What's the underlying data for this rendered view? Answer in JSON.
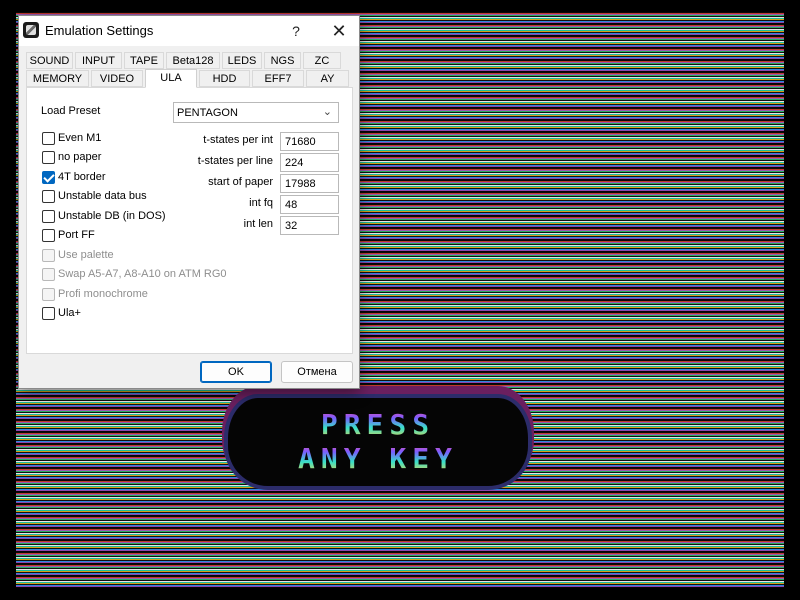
{
  "dialog": {
    "title": "Emulation Settings",
    "help": "?",
    "close": "✕"
  },
  "tabs": {
    "row1": [
      "SOUND",
      "INPUT",
      "TAPE",
      "Beta128",
      "LEDS",
      "NGS",
      "ZC"
    ],
    "row2": [
      "MEMORY",
      "VIDEO",
      "ULA",
      "HDD",
      "EFF7",
      "AY"
    ],
    "active": "ULA"
  },
  "ula": {
    "load_preset_label": "Load Preset",
    "preset_value": "PENTAGON",
    "checkboxes": [
      {
        "label": "Even M1",
        "checked": false,
        "disabled": false
      },
      {
        "label": "no paper",
        "checked": false,
        "disabled": false
      },
      {
        "label": "4T border",
        "checked": true,
        "disabled": false
      },
      {
        "label": "Unstable data bus",
        "checked": false,
        "disabled": false
      },
      {
        "label": "Unstable DB (in DOS)",
        "checked": false,
        "disabled": false
      },
      {
        "label": "Port FF",
        "checked": false,
        "disabled": false
      },
      {
        "label": "Use palette",
        "checked": false,
        "disabled": true
      },
      {
        "label": "Swap A5-A7, A8-A10 on ATM RG0",
        "checked": false,
        "disabled": true
      },
      {
        "label": "Profi monochrome",
        "checked": false,
        "disabled": true
      },
      {
        "label": "Ula+",
        "checked": false,
        "disabled": false
      }
    ],
    "fields": [
      {
        "label": "t-states per int",
        "value": "71680"
      },
      {
        "label": "t-states per line",
        "value": "224"
      },
      {
        "label": "start of paper",
        "value": "17988"
      },
      {
        "label": "int fq",
        "value": "48"
      },
      {
        "label": "int len",
        "value": "32"
      }
    ]
  },
  "buttons": {
    "ok": "OK",
    "cancel": "Отмена"
  },
  "emulator": {
    "banner_line1": "PRESS",
    "banner_line2": "ANY KEY"
  },
  "colors": {
    "accent": "#0067c0"
  }
}
